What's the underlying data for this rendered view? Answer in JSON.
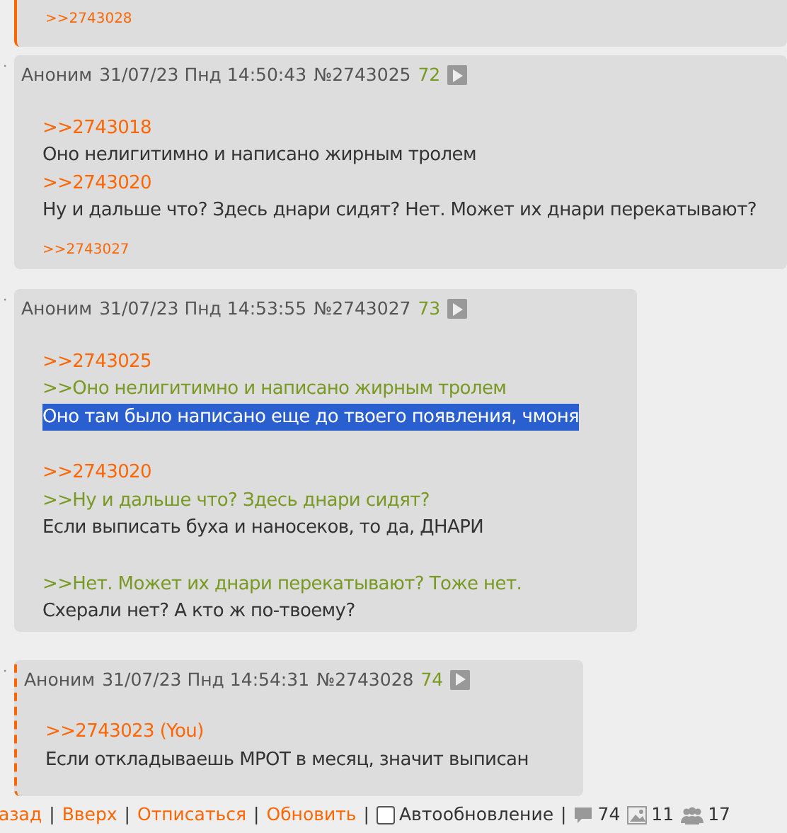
{
  "posts": [
    {
      "own_post": true,
      "reply_to_you": false,
      "backlinks": [
        ">>2743028"
      ]
    },
    {
      "marker": "·",
      "own_post": false,
      "reply_to_you": false,
      "author": "Аноним",
      "date": "31/07/23 Пнд 14:50:43",
      "number": "№2743025",
      "count": "72",
      "paragraphs": [
        [
          {
            "kind": "reply",
            "text": ">>2743018"
          },
          {
            "kind": "text",
            "text": "Оно нелигитимно и написано жирным тролем"
          },
          {
            "kind": "reply",
            "text": ">>2743020"
          },
          {
            "kind": "text",
            "text": "Ну и дальше что? Здесь днари сидят? Нет. Может их днари перекатывают?"
          }
        ]
      ],
      "backlinks": [
        ">>2743027"
      ]
    },
    {
      "marker": "·",
      "own_post": false,
      "reply_to_you": false,
      "author": "Аноним",
      "date": "31/07/23 Пнд 14:53:55",
      "number": "№2743027",
      "count": "73",
      "paragraphs": [
        [
          {
            "kind": "reply",
            "text": ">>2743025"
          },
          {
            "kind": "quote",
            "text": ">>Оно нелигитимно и написано жирным тролем"
          },
          {
            "kind": "text",
            "text": "Оно там было написано еще до твоего появления, чмоня",
            "selected": true
          }
        ],
        [
          {
            "kind": "reply",
            "text": ">>2743020"
          },
          {
            "kind": "quote",
            "text": ">>Ну и дальше что? Здесь днари сидят?"
          },
          {
            "kind": "text",
            "text": "Если выписать буха и наносеков, то да, ДНАРИ"
          }
        ],
        [
          {
            "kind": "quote",
            "text": ">>Нет. Может их днари перекатывают? Тоже нет."
          },
          {
            "kind": "text",
            "text": "Схерали нет? А кто ж по-твоему?"
          }
        ]
      ]
    },
    {
      "marker": "·",
      "own_post": false,
      "reply_to_you": true,
      "author": "Аноним",
      "date": "31/07/23 Пнд 14:54:31",
      "number": "№2743028",
      "count": "74",
      "paragraphs": [
        [
          {
            "kind": "reply",
            "text": ">>2743023 (You)"
          },
          {
            "kind": "text",
            "text": "Если откладываешь МРОТ в месяц, значит выписан"
          }
        ]
      ]
    }
  ],
  "footer": [
    {
      "kind": "link",
      "text": "азад"
    },
    {
      "kind": "separator",
      "text": "|"
    },
    {
      "kind": "link",
      "text": "Вверх"
    },
    {
      "kind": "separator",
      "text": "|"
    },
    {
      "kind": "link",
      "text": "Отписаться"
    },
    {
      "kind": "separator",
      "text": "|"
    },
    {
      "kind": "link",
      "text": "Обновить"
    },
    {
      "kind": "separator",
      "text": "|"
    },
    {
      "kind": "checkbox",
      "text": "Автообновление",
      "checked": false
    },
    {
      "kind": "separator",
      "text": "|"
    },
    {
      "kind": "posts",
      "text": "74"
    },
    {
      "kind": "images",
      "text": "11"
    },
    {
      "kind": "posters",
      "text": "17"
    }
  ]
}
